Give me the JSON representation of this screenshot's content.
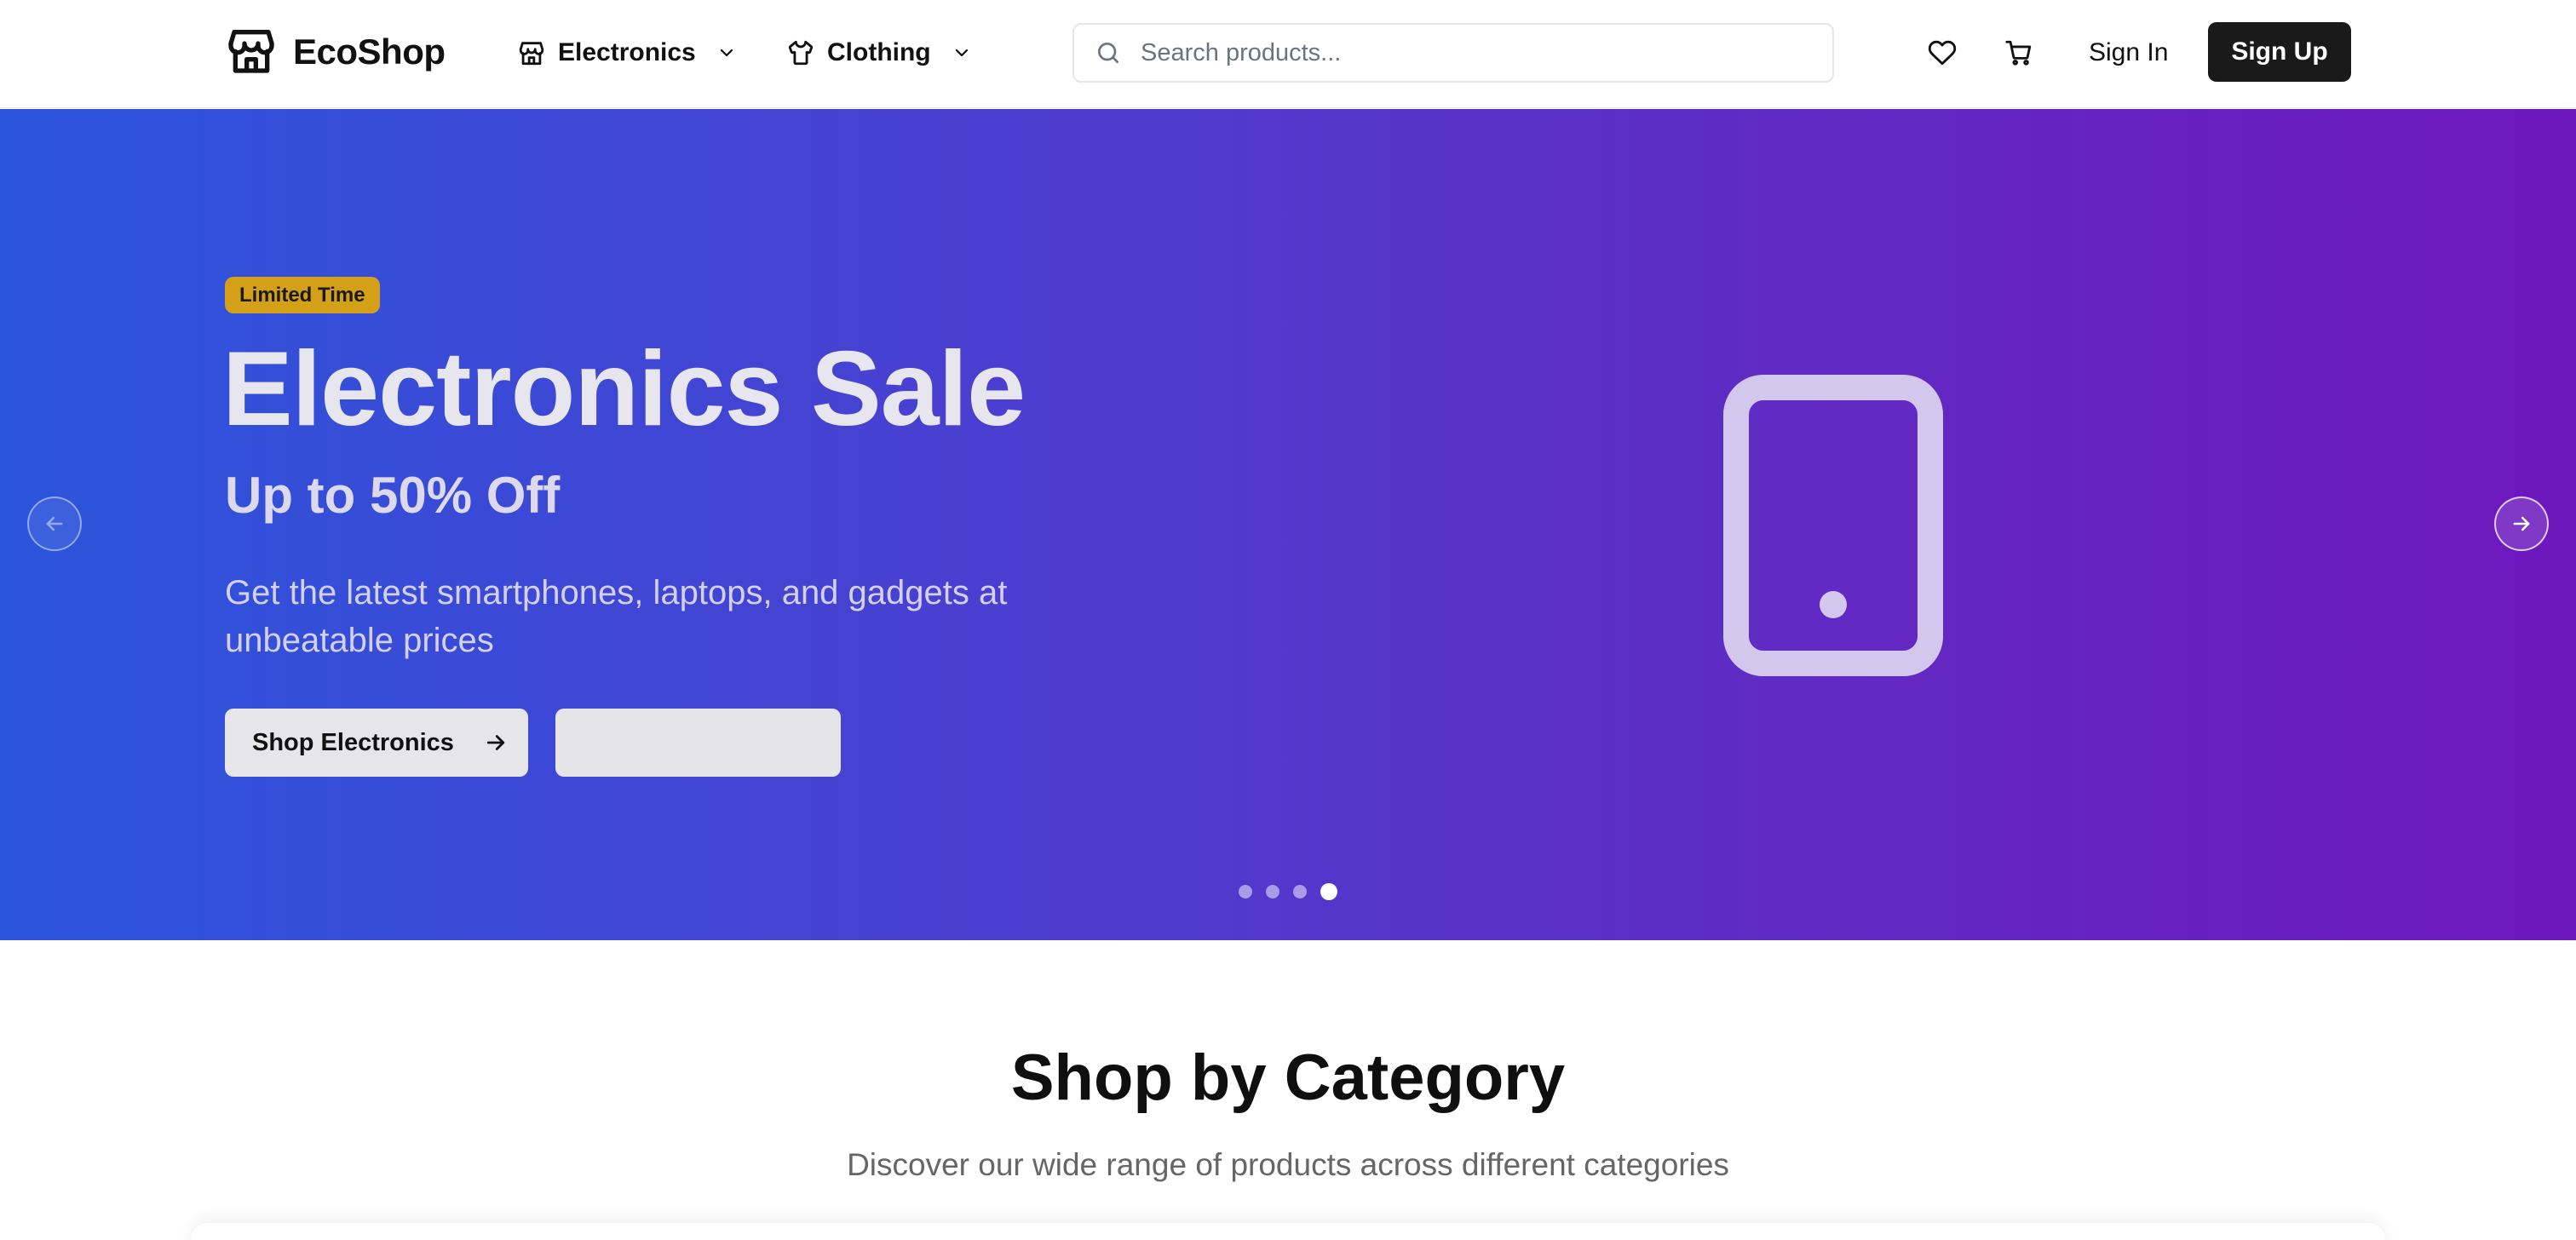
{
  "header": {
    "logo": {
      "text": "EcoShop",
      "icon": "store-icon"
    },
    "nav": [
      {
        "label": "Electronics",
        "icon": "store-icon",
        "dropdown_icon": "chevron-down-icon"
      },
      {
        "label": "Clothing",
        "icon": "shirt-icon",
        "dropdown_icon": "chevron-down-icon"
      }
    ],
    "search": {
      "placeholder": "Search products...",
      "value": "",
      "icon": "search-icon"
    },
    "actions": {
      "wishlist_icon": "heart-icon",
      "cart_icon": "cart-icon",
      "sign_in": "Sign In",
      "sign_up": "Sign Up"
    }
  },
  "hero": {
    "badge": "Limited Time",
    "title": "Electronics Sale",
    "subtitle": "Up to 50% Off",
    "description": "Get the latest smartphones, laptops, and gadgets at unbeatable prices",
    "primary_button": {
      "label": "Shop Electronics",
      "icon": "arrow-right-icon"
    },
    "secondary_button": {
      "label": ""
    },
    "illustration_icon": "smartphone-icon",
    "carousel": {
      "slide_count": 4,
      "active_index": 3,
      "prev_icon": "arrow-left-icon",
      "next_icon": "arrow-right-icon"
    },
    "colors": {
      "gradient_start": "#2b55dc",
      "gradient_end": "#6d17bd",
      "badge": "#d4a017"
    }
  },
  "categories": {
    "title": "Shop by Category",
    "subtitle": "Discover our wide range of products across different categories"
  },
  "colors": {
    "primary_button": "#1a1a1a",
    "text": "#111111",
    "muted_text": "#666666"
  }
}
